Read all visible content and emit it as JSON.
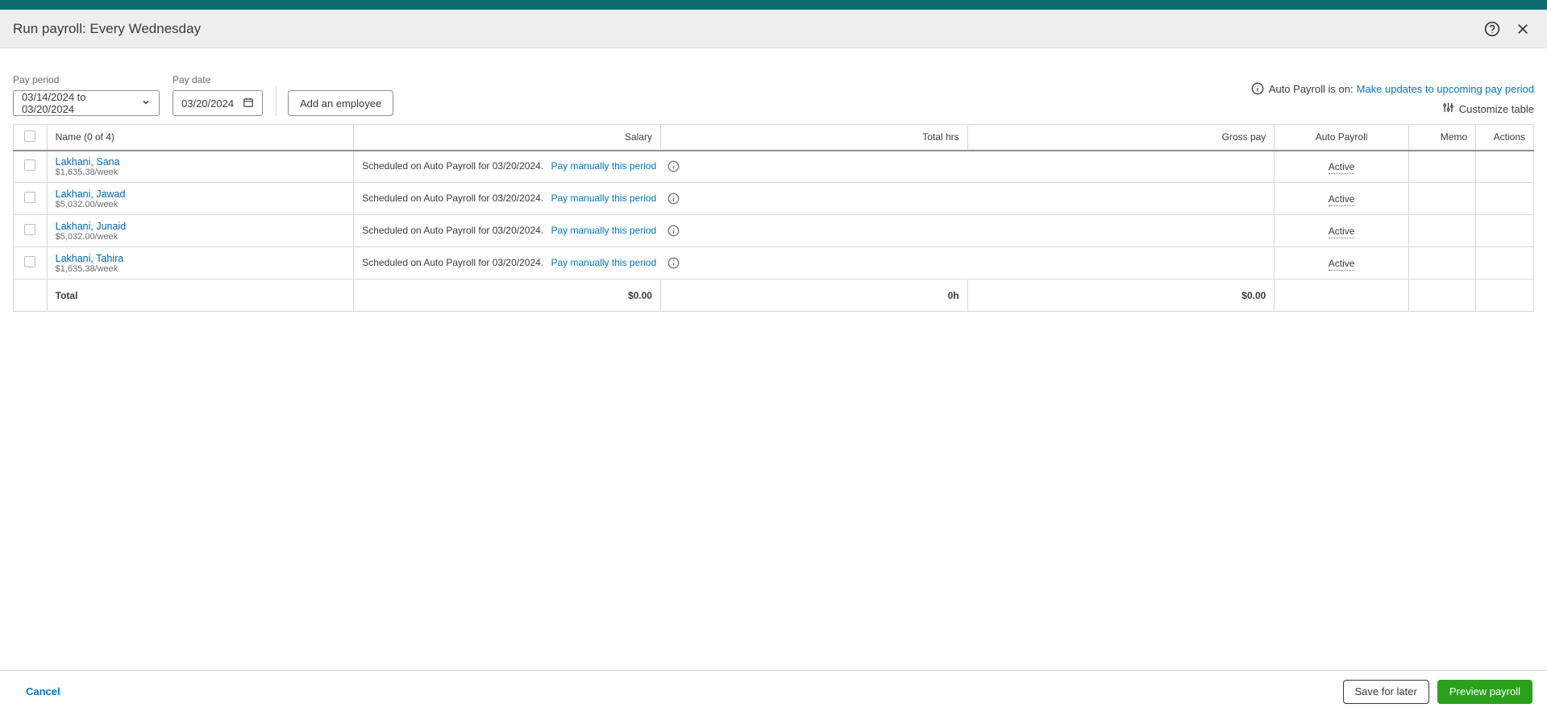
{
  "header": {
    "title": "Run payroll: Every Wednesday"
  },
  "controls": {
    "pay_period_label": "Pay period",
    "pay_period_value": "03/14/2024 to 03/20/2024",
    "pay_date_label": "Pay date",
    "pay_date_value": "03/20/2024",
    "add_employee_label": "Add an employee",
    "auto_payroll_text": "Auto Payroll is on:",
    "auto_payroll_link": "Make updates to upcoming pay period",
    "customize_label": "Customize table"
  },
  "table": {
    "columns": {
      "name": "Name (0 of 4)",
      "salary": "Salary",
      "total_hrs": "Total hrs",
      "gross_pay": "Gross pay",
      "auto_payroll": "Auto Payroll",
      "memo": "Memo",
      "actions": "Actions"
    },
    "scheduled_text": "Scheduled on Auto Payroll for 03/20/2024.",
    "pay_manually_label": "Pay manually this period",
    "active_label": "Active",
    "rows": [
      {
        "name": "Lakhani, Sana",
        "rate": "$1,635.38/week"
      },
      {
        "name": "Lakhani, Jawad",
        "rate": "$5,032.00/week"
      },
      {
        "name": "Lakhani, Junaid",
        "rate": "$5,032.00/week"
      },
      {
        "name": "Lakhani, Tahira",
        "rate": "$1,635.38/week"
      }
    ],
    "totals": {
      "label": "Total",
      "salary": "$0.00",
      "hrs": "0h",
      "gross": "$0.00"
    }
  },
  "footer": {
    "cancel": "Cancel",
    "save_later": "Save for later",
    "preview": "Preview payroll"
  }
}
